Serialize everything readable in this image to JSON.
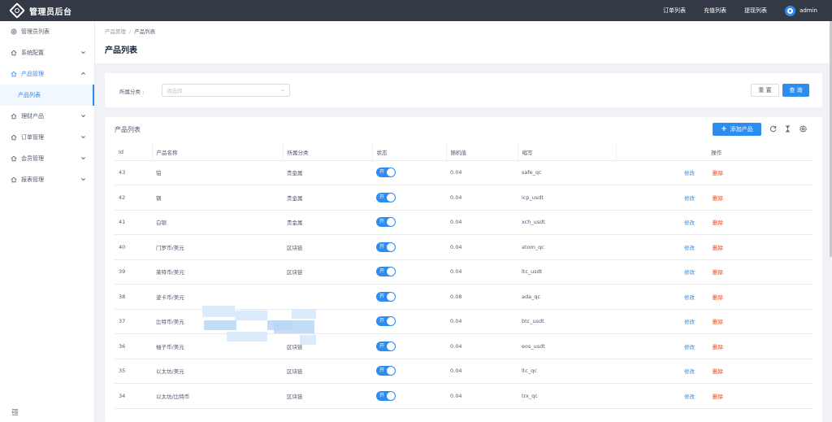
{
  "app": {
    "title": "管理员后台"
  },
  "topnav": {
    "links": [
      "订单列表",
      "充值列表",
      "提现列表"
    ],
    "user": "admin"
  },
  "sidebar": {
    "items": [
      {
        "label": "管理员列表",
        "icon": "settings-circle-icon"
      },
      {
        "label": "系统配置",
        "icon": "home-icon"
      },
      {
        "label": "产品管理",
        "icon": "home-icon"
      },
      {
        "label": "理财产品",
        "icon": "home-icon"
      },
      {
        "label": "订单管理",
        "icon": "home-icon"
      },
      {
        "label": "会员管理",
        "icon": "home-icon"
      },
      {
        "label": "报表管理",
        "icon": "home-icon"
      }
    ],
    "submenu": {
      "label": "产品列表"
    }
  },
  "breadcrumb": {
    "parent": "产品管理",
    "sep": "/",
    "current": "产品列表"
  },
  "page": {
    "title": "产品列表"
  },
  "filter": {
    "label": "所属分类 :",
    "placeholder": "请选择",
    "reset": "重 置",
    "query": "查 询"
  },
  "table": {
    "title": "产品列表",
    "add_label": "添加产品",
    "columns": [
      "Id",
      "产品名称",
      "所属分类",
      "状态",
      "随机值",
      "缩写",
      "操作"
    ],
    "switch_on": "开",
    "edit": "修改",
    "delete": "删除",
    "rows": [
      {
        "id": "43",
        "name": "铂",
        "category": "贵金属",
        "random": "0.04",
        "abbr": "safe_qc"
      },
      {
        "id": "42",
        "name": "钢",
        "category": "贵金属",
        "random": "0.04",
        "abbr": "icp_usdt"
      },
      {
        "id": "41",
        "name": "白银",
        "category": "贵金属",
        "random": "0.04",
        "abbr": "xch_usdt"
      },
      {
        "id": "40",
        "name": "门罗币/美元",
        "category": "区块链",
        "random": "0.04",
        "abbr": "atom_qc"
      },
      {
        "id": "39",
        "name": "莱特币/美元",
        "category": "区块链",
        "random": "0.04",
        "abbr": "ltc_usdt"
      },
      {
        "id": "38",
        "name": "波卡币/美元",
        "category": "",
        "random": "0.08",
        "abbr": "ada_qc"
      },
      {
        "id": "37",
        "name": "比特币/美元",
        "category": "",
        "random": "0.04",
        "abbr": "btc_usdt"
      },
      {
        "id": "36",
        "name": "柚子币/美元",
        "category": "区块链",
        "random": "0.04",
        "abbr": "eos_usdt"
      },
      {
        "id": "35",
        "name": "以太坊/美元",
        "category": "区块链",
        "random": "0.04",
        "abbr": "ltc_qc"
      },
      {
        "id": "34",
        "name": "以太坊/比特币",
        "category": "区块链",
        "random": "0.04",
        "abbr": "trx_qc"
      }
    ]
  }
}
